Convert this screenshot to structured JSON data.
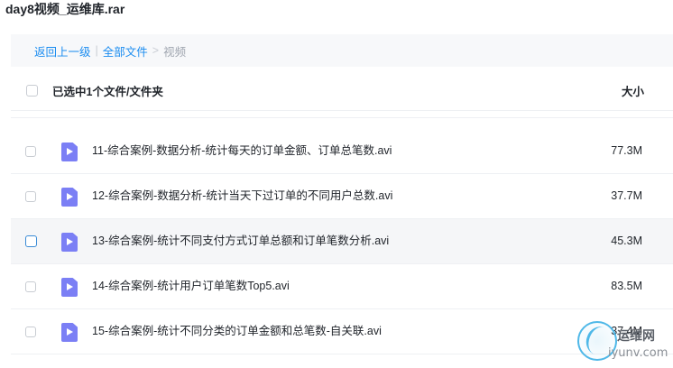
{
  "title": "day8视频_运维库.rar",
  "breadcrumb": {
    "back": "返回上一级",
    "sep1": "|",
    "all_files": "全部文件",
    "sep2": ">",
    "current": "视频"
  },
  "header": {
    "selected_label": "已选中1个文件/文件夹",
    "size_label": "大小"
  },
  "files": [
    {
      "name": "11-综合案例-数据分析-统计每天的订单金额、订单总笔数.avi",
      "size": "77.3M"
    },
    {
      "name": "12-综合案例-数据分析-统计当天下过订单的不同用户总数.avi",
      "size": "37.7M"
    },
    {
      "name": "13-综合案例-统计不同支付方式订单总额和订单笔数分析.avi",
      "size": "45.3M"
    },
    {
      "name": "14-综合案例-统计用户订单笔数Top5.avi",
      "size": "83.5M"
    },
    {
      "name": "15-综合案例-统计不同分类的订单金额和总笔数-自关联.avi",
      "size": "37.4M"
    }
  ],
  "icons": {
    "file_type": "video-file-icon",
    "file_color": "#7b7ff5"
  },
  "watermark": {
    "cn": "运维网",
    "en": "iyunv.com"
  }
}
